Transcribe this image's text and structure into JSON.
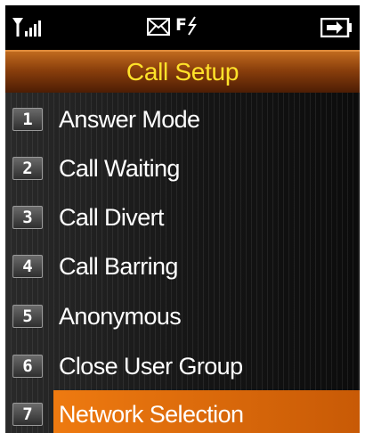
{
  "status_bar": {
    "icons": [
      "signal-strength-icon",
      "message-envelope-icon",
      "forward-flag-icon",
      "battery-icon"
    ],
    "forward_flag_text": "F"
  },
  "title": "Call Setup",
  "menu": {
    "items": [
      {
        "number": "1",
        "label": "Answer Mode"
      },
      {
        "number": "2",
        "label": "Call Waiting"
      },
      {
        "number": "3",
        "label": "Call Divert"
      },
      {
        "number": "4",
        "label": "Call Barring"
      },
      {
        "number": "5",
        "label": "Anonymous"
      },
      {
        "number": "6",
        "label": "Close User Group"
      },
      {
        "number": "7",
        "label": "Network Selection"
      }
    ],
    "selected_index": 6
  },
  "colors": {
    "title_text": "#ffe22a",
    "highlight": "#ee7a10",
    "background": "#000000"
  }
}
